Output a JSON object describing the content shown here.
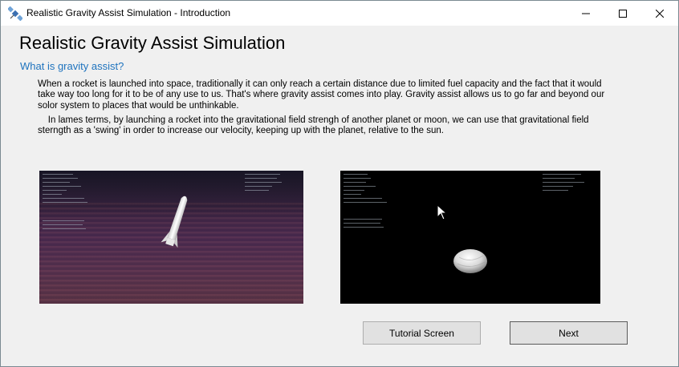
{
  "window": {
    "title": "Realistic Gravity Assist Simulation - Introduction"
  },
  "page": {
    "heading": "Realistic Gravity Assist Simulation",
    "subheading": "What is gravity assist?",
    "paragraph1": "When a rocket is launched into space, traditionally it can only reach a certain distance due to limited fuel capacity and the fact that it would take way too long for it to be of any use to us. That's where gravity assist comes into play. Gravity assist allows us to go far and beyond our solor system to places that would be unthinkable.",
    "paragraph2": "    In lames terms, by launching a rocket into the gravitational field strengh of another planet or moon, we can use that gravitational field sterngth as a 'swing' in order to increase our velocity, keeping up with the planet, relative to the sun."
  },
  "buttons": {
    "tutorial_label": "Tutorial Screen",
    "next_label": "Next"
  },
  "icons": {
    "app": "satellite-icon",
    "minimize": "minimize-icon",
    "maximize": "maximize-icon",
    "close": "close-icon",
    "cursor": "mouse-pointer-icon"
  },
  "colors": {
    "subheading": "#1e73be",
    "window_bg": "#f0f0f0",
    "button_bg": "#e1e1e1"
  }
}
